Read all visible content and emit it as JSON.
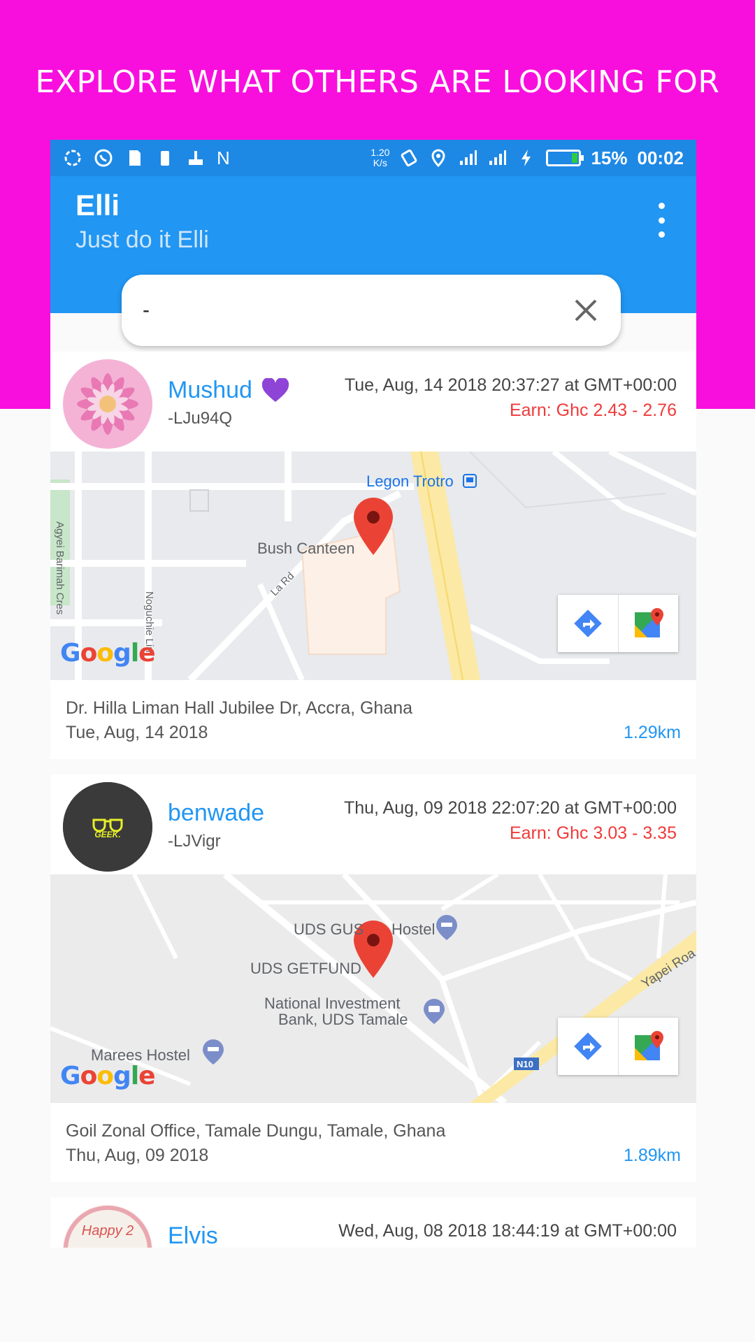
{
  "promo": {
    "title": "EXPLORE WHAT OTHERS ARE LOOKING FOR"
  },
  "status_bar": {
    "net_speed_value": "1.20",
    "net_speed_unit": "K/s",
    "battery": "15%",
    "time": "00:02",
    "n_label": "N"
  },
  "app": {
    "title": "Elli",
    "subtitle": "Just do it Elli"
  },
  "search": {
    "value": "-"
  },
  "colors": {
    "promo_bg": "#f80fdd",
    "app_bar": "#2196f3",
    "status_bar": "#1e88e5",
    "earn": "#f03a3a",
    "accent": "#2196f3"
  },
  "cards": [
    {
      "name": "Mushud",
      "badge": "heart-icon",
      "user_id": "-LJu94Q",
      "datetime": "Tue, Aug, 14 2018 20:37:27 at GMT+00:00",
      "earn": "Earn: Ghc 2.43 - 2.76",
      "map_labels": {
        "poi1": "Legon Trotro",
        "poi2": "Bush Canteen",
        "road1": "Agyei Barimah Cres",
        "road2": "Noguchie Lin",
        "road3": "La Rd"
      },
      "address": "Dr. Hilla Liman Hall Jubilee Dr, Accra, Ghana",
      "date": "Tue, Aug, 14 2018",
      "distance": "1.29km"
    },
    {
      "name": "benwade",
      "user_id": "-LJVigr",
      "avatar_text": "GEEK.",
      "datetime": "Thu, Aug, 09 2018 22:07:20 at GMT+00:00",
      "earn": "Earn: Ghc 3.03 - 3.35",
      "map_labels": {
        "poi1": "UDS GUS",
        "poi1b": "Hostel",
        "poi2": "UDS GETFUND",
        "poi3a": "National Investment",
        "poi3b": "Bank, UDS Tamale",
        "poi4": "Marees Hostel",
        "road1": "Yapei Roa",
        "shield": "N10"
      },
      "address": "Goil Zonal Office, Tamale Dungu, Tamale, Ghana",
      "date": "Thu, Aug, 09 2018",
      "distance": "1.89km"
    },
    {
      "name": "Elvis",
      "avatar_text": "Happy 2",
      "datetime": "Wed, Aug, 08 2018 18:44:19 at GMT+00:00"
    }
  ],
  "map_logo": "Google"
}
